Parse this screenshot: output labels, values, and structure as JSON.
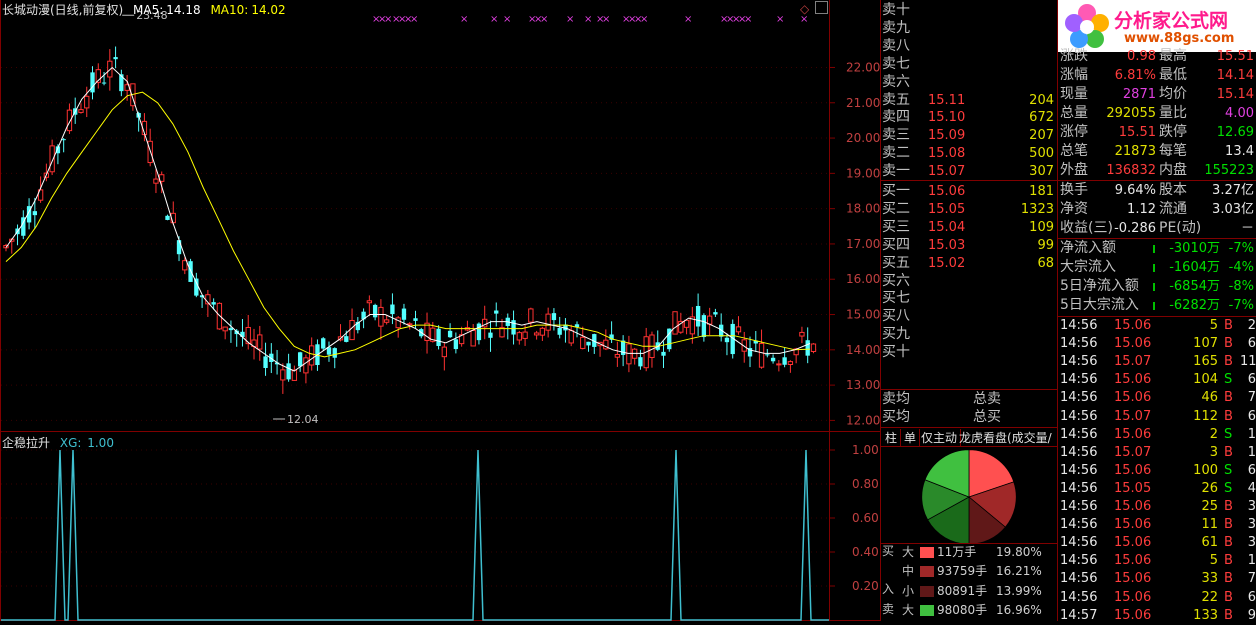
{
  "chart": {
    "title": "长城动漫(日线,前复权)",
    "ma5_label": "MA5:",
    "ma5_value": "14.18",
    "ma10_label": "MA10:",
    "ma10_value": "14.02",
    "high_label": "23.48",
    "low_label": "12.04",
    "price_ticks": [
      "22.00",
      "21.00",
      "20.00",
      "19.00",
      "18.00",
      "17.00",
      "16.00",
      "15.00",
      "14.00",
      "13.00",
      "12.00"
    ],
    "indicator_title": "企稳拉升",
    "indicator_xg_label": "XG:",
    "indicator_xg_value": "1.00",
    "indicator_ticks": [
      "1.00",
      "0.80",
      "0.60",
      "0.40",
      "0.20"
    ],
    "marker_glyph": "×",
    "colors": {
      "up": "#ff3232",
      "down": "#54ffff",
      "ma5": "#ffffff",
      "ma10": "#ffff00",
      "ind": "#3fbfcf",
      "grid": "#800000",
      "marker": "#e040e0"
    }
  },
  "chart_data": {
    "type": "line",
    "title": "长城动漫(日线,前复权)",
    "ylim": [
      11.7,
      23.6
    ],
    "series": [
      {
        "name": "MA5",
        "values": [
          16.9,
          17.5,
          18.3,
          19.3,
          20.3,
          21.1,
          21.6,
          22.0,
          21.6,
          20.3,
          19.0,
          17.6,
          16.4,
          15.5,
          15.0,
          14.6,
          14.2,
          13.9,
          13.6,
          13.4,
          13.7,
          14.0,
          14.3,
          14.7,
          15.0,
          15.0,
          14.8,
          14.6,
          14.3,
          14.2,
          14.4,
          14.6,
          14.8,
          14.8,
          14.7,
          14.8,
          14.7,
          14.6,
          14.4,
          14.2,
          14.0,
          13.9,
          13.9,
          14.1,
          14.6,
          14.9,
          14.8,
          14.6,
          14.3,
          14.0,
          13.9,
          13.9,
          14.0,
          14.18
        ]
      },
      {
        "name": "MA10",
        "values": [
          16.5,
          16.9,
          17.5,
          18.3,
          19.0,
          19.6,
          20.2,
          20.8,
          21.2,
          21.3,
          21.0,
          20.4,
          19.6,
          18.6,
          17.7,
          16.8,
          16.0,
          15.2,
          14.6,
          14.1,
          13.9,
          13.8,
          13.9,
          14.0,
          14.2,
          14.4,
          14.6,
          14.7,
          14.7,
          14.6,
          14.6,
          14.6,
          14.6,
          14.6,
          14.6,
          14.7,
          14.7,
          14.7,
          14.6,
          14.5,
          14.3,
          14.2,
          14.1,
          14.1,
          14.2,
          14.3,
          14.4,
          14.4,
          14.4,
          14.3,
          14.2,
          14.1,
          14.0,
          14.02
        ]
      }
    ],
    "indicator": {
      "name": "XG",
      "values": [
        0,
        1,
        1,
        0,
        0,
        0,
        0,
        0,
        1,
        0,
        0,
        0,
        0,
        1,
        0,
        0,
        0,
        1
      ],
      "ylim": [
        0,
        1
      ]
    }
  },
  "quote": {
    "sell_levels": [
      {
        "label": "卖十",
        "price": "",
        "vol": ""
      },
      {
        "label": "卖九",
        "price": "",
        "vol": ""
      },
      {
        "label": "卖八",
        "price": "",
        "vol": ""
      },
      {
        "label": "卖七",
        "price": "",
        "vol": ""
      },
      {
        "label": "卖六",
        "price": "",
        "vol": ""
      },
      {
        "label": "卖五",
        "price": "15.11",
        "vol": "204"
      },
      {
        "label": "卖四",
        "price": "15.10",
        "vol": "672"
      },
      {
        "label": "卖三",
        "price": "15.09",
        "vol": "207"
      },
      {
        "label": "卖二",
        "price": "15.08",
        "vol": "500"
      },
      {
        "label": "卖一",
        "price": "15.07",
        "vol": "307"
      }
    ],
    "buy_levels": [
      {
        "label": "买一",
        "price": "15.06",
        "vol": "181"
      },
      {
        "label": "买二",
        "price": "15.05",
        "vol": "1323"
      },
      {
        "label": "买三",
        "price": "15.04",
        "vol": "109"
      },
      {
        "label": "买四",
        "price": "15.03",
        "vol": "99"
      },
      {
        "label": "买五",
        "price": "15.02",
        "vol": "68"
      },
      {
        "label": "买六",
        "price": "",
        "vol": ""
      },
      {
        "label": "买七",
        "price": "",
        "vol": ""
      },
      {
        "label": "买八",
        "price": "",
        "vol": ""
      },
      {
        "label": "买九",
        "price": "",
        "vol": ""
      },
      {
        "label": "买十",
        "price": "",
        "vol": ""
      }
    ],
    "avg_sell_label": "卖均",
    "total_sell_label": "总卖",
    "avg_buy_label": "买均",
    "total_buy_label": "总买"
  },
  "tabs": [
    "柱",
    "单",
    "仅主动",
    "龙虎看盘(成交量/股"
  ],
  "flow": {
    "buy_side_label": "买",
    "in_label": "入",
    "sell_side_label": "卖",
    "rows": [
      {
        "size": "大",
        "value": "11万手",
        "pct": "19.80%",
        "color": "#ff5050"
      },
      {
        "size": "中",
        "value": "93759手",
        "pct": "16.21%",
        "color": "#a02828"
      },
      {
        "size": "小",
        "value": "80891手",
        "pct": "13.99%",
        "color": "#601818"
      },
      {
        "size": "大",
        "value": "98080手",
        "pct": "16.96%",
        "color": "#40c040"
      }
    ],
    "pie": [
      {
        "pct": 19.8,
        "color": "#ff5050"
      },
      {
        "pct": 16.21,
        "color": "#a02828"
      },
      {
        "pct": 13.99,
        "color": "#601818"
      },
      {
        "pct": 16.96,
        "color": "#1a6a1a"
      },
      {
        "pct": 14.0,
        "color": "#2a8a2a"
      },
      {
        "pct": 19.04,
        "color": "#40c040"
      }
    ]
  },
  "logo": {
    "title": "分析家公式网",
    "url": "www.88gs.com"
  },
  "stats": [
    {
      "l1": "涨跌",
      "v1": "0.98",
      "c1": "red",
      "l2": "最高",
      "v2": "15.51",
      "c2": "red"
    },
    {
      "l1": "涨幅",
      "v1": "6.81%",
      "c1": "red",
      "l2": "最低",
      "v2": "14.14",
      "c2": "red"
    },
    {
      "l1": "现量",
      "v1": "2871",
      "c1": "magenta",
      "l2": "均价",
      "v2": "15.14",
      "c2": "red"
    },
    {
      "l1": "总量",
      "v1": "292055",
      "c1": "yellow",
      "l2": "量比",
      "v2": "4.00",
      "c2": "magenta"
    },
    {
      "l1": "涨停",
      "v1": "15.51",
      "c1": "red",
      "l2": "跌停",
      "v2": "12.69",
      "c2": "green"
    },
    {
      "l1": "总笔",
      "v1": "21873",
      "c1": "yellow",
      "l2": "每笔",
      "v2": "13.4",
      "c2": "white"
    },
    {
      "l1": "外盘",
      "v1": "136832",
      "c1": "red",
      "l2": "内盘",
      "v2": "155223",
      "c2": "green"
    }
  ],
  "stats2": [
    {
      "l1": "换手",
      "v1": "9.64%",
      "l2": "股本",
      "v2": "3.27亿"
    },
    {
      "l1": "净资",
      "v1": "1.12",
      "l2": "流通",
      "v2": "3.03亿"
    },
    {
      "l1": "收益(三)",
      "v1": "-0.286",
      "l2": "PE(动)",
      "v2": "－"
    }
  ],
  "capital": [
    {
      "label": "净流入额",
      "value": "-3010万",
      "pct": "-7%"
    },
    {
      "label": "大宗流入",
      "value": "-1604万",
      "pct": "-4%"
    },
    {
      "label": "5日净流入额",
      "value": "-6854万",
      "pct": "-8%"
    },
    {
      "label": "5日大宗流入",
      "value": "-6282万",
      "pct": "-7%"
    }
  ],
  "ticks": [
    {
      "t": "14:56",
      "p": "15.06",
      "v": "5",
      "s": "B",
      "n": "2"
    },
    {
      "t": "14:56",
      "p": "15.06",
      "v": "107",
      "s": "B",
      "n": "6"
    },
    {
      "t": "14:56",
      "p": "15.07",
      "v": "165",
      "s": "B",
      "n": "11"
    },
    {
      "t": "14:56",
      "p": "15.06",
      "v": "104",
      "s": "S",
      "n": "6"
    },
    {
      "t": "14:56",
      "p": "15.06",
      "v": "46",
      "s": "B",
      "n": "7"
    },
    {
      "t": "14:56",
      "p": "15.07",
      "v": "112",
      "s": "B",
      "n": "6"
    },
    {
      "t": "14:56",
      "p": "15.06",
      "v": "2",
      "s": "S",
      "n": "1"
    },
    {
      "t": "14:56",
      "p": "15.07",
      "v": "3",
      "s": "B",
      "n": "1"
    },
    {
      "t": "14:56",
      "p": "15.06",
      "v": "100",
      "s": "S",
      "n": "6"
    },
    {
      "t": "14:56",
      "p": "15.05",
      "v": "26",
      "s": "S",
      "n": "4"
    },
    {
      "t": "14:56",
      "p": "15.06",
      "v": "25",
      "s": "B",
      "n": "3"
    },
    {
      "t": "14:56",
      "p": "15.06",
      "v": "11",
      "s": "B",
      "n": "3"
    },
    {
      "t": "14:56",
      "p": "15.06",
      "v": "61",
      "s": "B",
      "n": "3"
    },
    {
      "t": "14:56",
      "p": "15.06",
      "v": "5",
      "s": "B",
      "n": "1"
    },
    {
      "t": "14:56",
      "p": "15.06",
      "v": "33",
      "s": "B",
      "n": "7"
    },
    {
      "t": "14:56",
      "p": "15.06",
      "v": "22",
      "s": "B",
      "n": "6"
    },
    {
      "t": "14:57",
      "p": "15.06",
      "v": "133",
      "s": "B",
      "n": "9"
    }
  ]
}
